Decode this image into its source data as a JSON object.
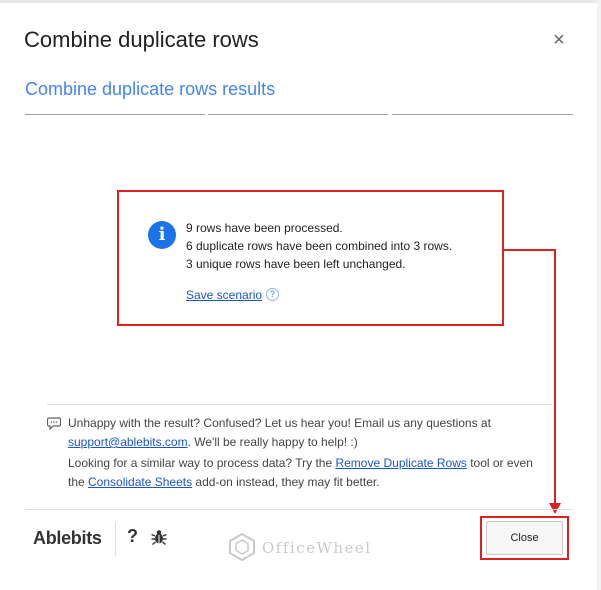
{
  "dialog": {
    "title": "Combine duplicate rows",
    "subtitle": "Combine duplicate rows results",
    "close_icon": "×"
  },
  "result": {
    "icon": "i",
    "lines": [
      "9 rows have been processed.",
      "6 duplicate rows have been combined into 3 rows.",
      "3 unique rows have been left unchanged."
    ],
    "save_label": "Save scenario",
    "help_icon": "?"
  },
  "feedback": {
    "line1_prefix": "Unhappy with the result? Confused? Let us hear you! Email us any questions at",
    "email": "support@ablebits.com",
    "line1_suffix": ". We'll be really happy to help! :)",
    "line2_prefix": "Looking for a similar way to process data? Try the ",
    "link1": "Remove Duplicate Rows",
    "line2_mid": " tool or even the ",
    "link2": "Consolidate Sheets",
    "line2_suffix": " add-on instead, they may fit better."
  },
  "footer": {
    "brand": "Ablebits",
    "help": "?",
    "close_label": "Close",
    "watermark": "OfficeWheel"
  },
  "colors": {
    "accent": "#4285f4",
    "info": "#1a73e8",
    "highlight": "#e02020"
  }
}
